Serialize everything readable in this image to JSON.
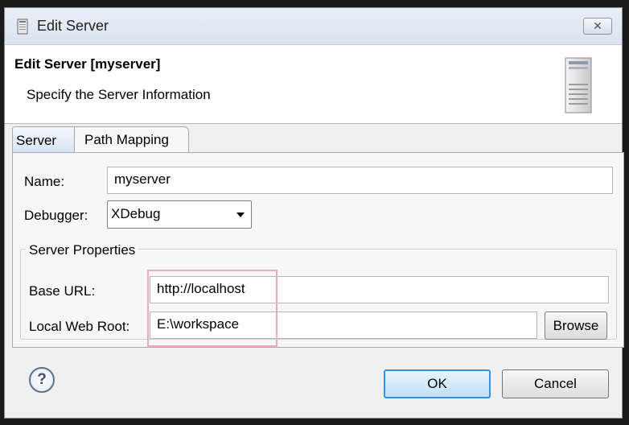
{
  "window": {
    "title": "Edit Server",
    "close_label": "✕"
  },
  "header": {
    "title": "Edit Server [myserver]",
    "subtitle": "Specify the Server Information"
  },
  "tabs": [
    {
      "label": "Server",
      "selected": true
    },
    {
      "label": "Path Mapping",
      "selected": false
    }
  ],
  "form": {
    "name_label": "Name:",
    "name_value": "myserver",
    "debugger_label": "Debugger:",
    "debugger_value": "XDebug",
    "group_title": "Server Properties",
    "base_url_label": "Base URL:",
    "base_url_value": "http://localhost",
    "web_root_label": "Local Web Root:",
    "web_root_value": "E:\\workspace",
    "browse_label": "Browse"
  },
  "footer": {
    "help_symbol": "?",
    "ok_label": "OK",
    "cancel_label": "Cancel"
  },
  "colors": {
    "highlight_border": "#f2a7c6",
    "ok_border": "#3c8ed6"
  }
}
